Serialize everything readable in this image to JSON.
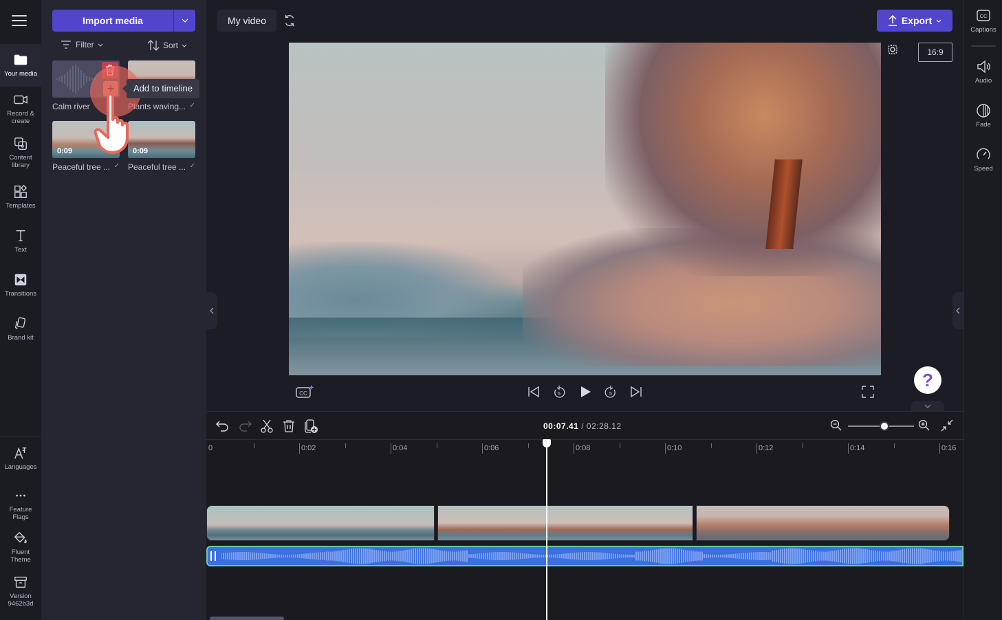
{
  "leftnav": {
    "items": [
      {
        "label": "Your media",
        "icon": "folder-icon",
        "active": true
      },
      {
        "label": "Record &\ncreate",
        "icon": "camera-icon"
      },
      {
        "label": "Content\nlibrary",
        "icon": "content-library-icon"
      },
      {
        "label": "Templates",
        "icon": "templates-icon"
      },
      {
        "label": "Text",
        "icon": "text-icon"
      },
      {
        "label": "Transitions",
        "icon": "transitions-icon"
      },
      {
        "label": "Brand kit",
        "icon": "brand-kit-icon"
      }
    ],
    "bottom_items": [
      {
        "label": "Languages",
        "icon": "languages-icon"
      },
      {
        "label": "Feature\nFlags",
        "icon": "more-icon"
      },
      {
        "label": "Fluent\nTheme",
        "icon": "paint-bucket-icon"
      },
      {
        "label": "Version\n9462b3d",
        "icon": "archive-icon"
      }
    ]
  },
  "media_panel": {
    "import_label": "Import media",
    "filter_label": "Filter",
    "sort_label": "Sort",
    "tooltip": "Add to timeline",
    "items": [
      {
        "name": "Calm river",
        "type": "audio",
        "duration": "",
        "added": false
      },
      {
        "name": "Plants waving...",
        "type": "video",
        "duration": "",
        "added": true
      },
      {
        "name": "Peaceful tree ...",
        "type": "video",
        "duration": "0:09",
        "added": true
      },
      {
        "name": "Peaceful tree ...",
        "type": "video",
        "duration": "0:09",
        "added": true
      }
    ],
    "check_glyph": "✓"
  },
  "topbar": {
    "project_title": "My video",
    "export_label": "Export",
    "aspect_ratio": "16:9"
  },
  "player": {
    "help_glyph": "?"
  },
  "timeline": {
    "current_time": "00:07.41",
    "separator": " / ",
    "total_time": "02:28.12",
    "zoom_level": 0.55,
    "ruler_labels": [
      "0",
      "0:02",
      "0:04",
      "0:06",
      "0:08",
      "0:10",
      "0:12",
      "0:14",
      "0:16"
    ],
    "playhead_seconds": 7.41
  },
  "rightpanel": {
    "items": [
      {
        "label": "Captions",
        "icon": "captions-icon"
      },
      {
        "label": "Audio",
        "icon": "speaker-icon"
      },
      {
        "label": "Fade",
        "icon": "fade-icon"
      },
      {
        "label": "Speed",
        "icon": "speedometer-icon"
      }
    ]
  }
}
